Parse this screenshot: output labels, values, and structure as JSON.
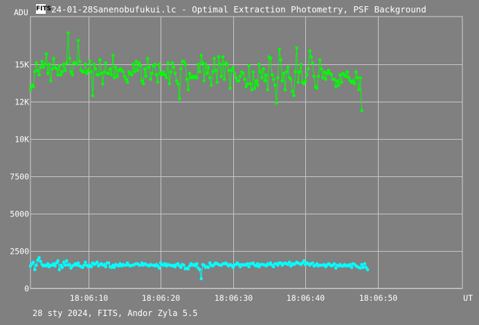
{
  "header": {
    "icon_label": "FITS",
    "title": "24-01-28Sanenobufukui.lc - Optimal Extraction Photometry, PSF Background"
  },
  "footer": {
    "info": "28 sty 2024, FITS, Andor Zyla 5.5"
  },
  "chart_data": {
    "type": "scatter",
    "ylabel": "ADU",
    "xlabel": "UT",
    "ylim": [
      0,
      18200
    ],
    "xlim": [
      2.0,
      61.7
    ],
    "x_unit": "seconds after 18:06:00",
    "yticks": [
      {
        "value": 0,
        "label": "0"
      },
      {
        "value": 2500,
        "label": "2500"
      },
      {
        "value": 5000,
        "label": "5000"
      },
      {
        "value": 7500,
        "label": "7500"
      },
      {
        "value": 10000,
        "label": "10K"
      },
      {
        "value": 12500,
        "label": "12K"
      },
      {
        "value": 15000,
        "label": "15K"
      }
    ],
    "xticks": [
      {
        "value": 10,
        "label": "18:06:10"
      },
      {
        "value": 20,
        "label": "18:06:20"
      },
      {
        "value": 30,
        "label": "18:06:30"
      },
      {
        "value": 40,
        "label": "18:06:40"
      },
      {
        "value": 50,
        "label": "18:06:50"
      }
    ],
    "grid": true,
    "series": [
      {
        "color": "#00ff00",
        "x_start": 2.0,
        "x_step": 0.2,
        "values": [
          13300,
          13600,
          13500,
          14500,
          15100,
          14600,
          14300,
          14800,
          15200,
          14800,
          15000,
          15700,
          14400,
          15000,
          13900,
          14700,
          15400,
          14800,
          14700,
          14300,
          14900,
          14300,
          14500,
          15000,
          14600,
          15100,
          17100,
          15400,
          14500,
          14300,
          15100,
          15100,
          15000,
          16600,
          15200,
          14600,
          14500,
          14500,
          15000,
          14400,
          14600,
          15200,
          14500,
          12900,
          15000,
          14700,
          14300,
          14300,
          15300,
          14400,
          13700,
          14500,
          15100,
          14400,
          14400,
          14700,
          14300,
          15600,
          14100,
          14800,
          14200,
          14600,
          14700,
          14600,
          14500,
          14200,
          14000,
          13800,
          14500,
          14400,
          14300,
          15000,
          14500,
          15200,
          14600,
          15100,
          14900,
          13900,
          13700,
          14700,
          14200,
          15400,
          14800,
          14000,
          14400,
          14900,
          15000,
          14300,
          13800,
          15000,
          14400,
          14300,
          14500,
          14300,
          14100,
          15100,
          13700,
          14500,
          15100,
          14800,
          14400,
          13900,
          13700,
          12700,
          14700,
          15200,
          15200,
          15000,
          14000,
          13300,
          14400,
          14100,
          14200,
          14100,
          14200,
          14100,
          15000,
          14500,
          15600,
          15100,
          13900,
          15000,
          14400,
          14800,
          14100,
          13600,
          14500,
          15400,
          14600,
          13800,
          15500,
          15000,
          14200,
          15500,
          14000,
          15100,
          15000,
          14600,
          13400,
          14600,
          14800,
          14400,
          14100,
          13900,
          13900,
          14200,
          14500,
          14400,
          14000,
          13500,
          13700,
          14900,
          13700,
          13300,
          14500,
          13400,
          13900,
          13600,
          15000,
          14500,
          14100,
          14700,
          13900,
          14300,
          13300,
          15500,
          15400,
          14300,
          14000,
          13600,
          12400,
          14100,
          16000,
          15300,
          13900,
          14400,
          13300,
          14500,
          14800,
          14100,
          14000,
          13200,
          12900,
          14500,
          16100,
          13800,
          14500,
          15000,
          13800,
          13700,
          13900,
          14300,
          14700,
          15900,
          15500,
          15100,
          14200,
          13500,
          13400,
          14200,
          15300,
          14700,
          14100,
          14500,
          14000,
          14400,
          14600,
          14400,
          14300,
          14000,
          14000,
          13500,
          13900,
          13600,
          14300,
          13800,
          14400,
          14300,
          14200,
          14500,
          14100,
          13900,
          13800,
          13900,
          13700,
          14500,
          14100,
          13300,
          14100,
          11900
        ]
      },
      {
        "color": "#00ffff",
        "x_start": 2.0,
        "x_step": 0.2,
        "values": [
          1500,
          1650,
          1750,
          1250,
          1550,
          1900,
          2050,
          1800,
          1600,
          1500,
          1550,
          1500,
          1650,
          1450,
          1550,
          1550,
          1650,
          1500,
          1700,
          1850,
          1250,
          1550,
          1400,
          1750,
          1550,
          1850,
          1550,
          1600,
          1350,
          1500,
          1550,
          1650,
          1550,
          1700,
          1500,
          1450,
          1400,
          1550,
          1750,
          1550,
          1450,
          1550,
          1450,
          1700,
          1600,
          1650,
          1750,
          1500,
          1600,
          1650,
          1550,
          1600,
          1450,
          1700,
          1700,
          1450,
          1400,
          1550,
          1400,
          1600,
          1550,
          1500,
          1650,
          1500,
          1600,
          1550,
          1550,
          1700,
          1550,
          1500,
          1550,
          1550,
          1600,
          1650,
          1650,
          1550,
          1550,
          1700,
          1550,
          1650,
          1600,
          1550,
          1500,
          1600,
          1550,
          1550,
          1500,
          1600,
          1500,
          1350,
          1700,
          1600,
          1550,
          1650,
          1500,
          1600,
          1550,
          1550,
          1500,
          1550,
          1450,
          1600,
          1650,
          1500,
          1400,
          1600,
          1550,
          1300,
          1350,
          1300,
          1500,
          1650,
          1550,
          1600,
          1500,
          1650,
          1350,
          1250,
          650,
          1600,
          1550,
          1400,
          1450,
          1400,
          1700,
          1550,
          1500,
          1600,
          1700,
          1650,
          1600,
          1550,
          1550,
          1650,
          1650,
          1700,
          1600,
          1500,
          1600,
          1550,
          1400,
          1550,
          1600,
          1700,
          1600,
          1450,
          1600,
          1550,
          1600,
          1550,
          1650,
          1450,
          1650,
          1650,
          1700,
          1550,
          1500,
          1650,
          1450,
          1600,
          1600,
          1600,
          1550,
          1500,
          1650,
          1600,
          1700,
          1550,
          1450,
          1650,
          1650,
          1550,
          1700,
          1700,
          1550,
          1650,
          1700,
          1650,
          1600,
          1750,
          1500,
          1650,
          1600,
          1650,
          1750,
          1700,
          1650,
          1600,
          1700,
          1850,
          1600,
          1700,
          1650,
          1550,
          1650,
          1700,
          1500,
          1550,
          1650,
          1500,
          1550,
          1550,
          1550,
          1600,
          1450,
          1550,
          1650,
          1600,
          1500,
          1550,
          1650,
          1350,
          1550,
          1500,
          1600,
          1500,
          1500,
          1600,
          1500,
          1550,
          1500,
          1600,
          1400,
          1650,
          1600,
          1500,
          1450,
          1400,
          1350,
          1600,
          1400,
          1650,
          1400,
          1250
        ]
      }
    ]
  }
}
